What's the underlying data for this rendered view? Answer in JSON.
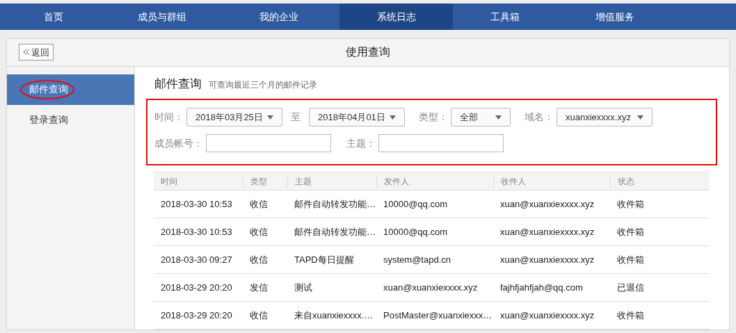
{
  "nav": [
    {
      "label": "首页",
      "selected": false
    },
    {
      "label": "成员与群组",
      "selected": false
    },
    {
      "label": "我的企业",
      "selected": false
    },
    {
      "label": "系统日志",
      "selected": true
    },
    {
      "label": "工具箱",
      "selected": false
    },
    {
      "label": "增值服务",
      "selected": false
    }
  ],
  "header": {
    "back": "返回",
    "title": "使用查询"
  },
  "sidebar": {
    "items": [
      {
        "label": "邮件查询",
        "selected": true,
        "circled": true
      },
      {
        "label": "登录查询",
        "selected": false,
        "circled": false
      }
    ]
  },
  "main": {
    "title": "邮件查询",
    "subtitle": "可查询最近三个月的邮件记录",
    "filters": {
      "outlined": true,
      "rows": [
        {
          "fields": [
            {
              "kind": "select",
              "label": "时间：",
              "value": "2018年03月25日"
            },
            {
              "kind": "text",
              "label": "至"
            },
            {
              "kind": "select",
              "value": "2018年04月01日"
            },
            {
              "kind": "select",
              "label": "类型：",
              "value": "全部"
            },
            {
              "kind": "select",
              "label": "域名：",
              "value": "xuanxiexxxx.xyz"
            }
          ]
        },
        {
          "fields": [
            {
              "kind": "input",
              "label": "成员帐号："
            },
            {
              "kind": "input",
              "label": "主题："
            }
          ]
        }
      ]
    },
    "table": {
      "columns": [
        "时间",
        "类型",
        "主题",
        "发件人",
        "收件人",
        "状态"
      ],
      "rows": [
        [
          "2018-03-30 10:53",
          "收信",
          "邮件自动转发功能…",
          "10000@qq.com",
          "xuan@xuanxiexxxx.xyz",
          "收件箱"
        ],
        [
          "2018-03-30 10:53",
          "收信",
          "邮件自动转发功能…",
          "10000@qq.com",
          "xuan@xuanxiexxxx.xyz",
          "收件箱"
        ],
        [
          "2018-03-30 09:27",
          "收信",
          "TAPD每日提醒",
          "system@tapd.cn",
          "xuan@xuanxiexxxx.xyz",
          "收件箱"
        ],
        [
          "2018-03-29 20:20",
          "发信",
          "测试",
          "xuan@xuanxiexxxx.xyz",
          "fajhfjahfjah@qq.com",
          "已退信"
        ],
        [
          "2018-03-29 20:20",
          "收信",
          "来自xuanxiexxxx.…",
          "PostMaster@xuanxiexxx…",
          "xuan@xuanxiexxxx.xyz",
          "收件箱"
        ]
      ]
    }
  }
}
